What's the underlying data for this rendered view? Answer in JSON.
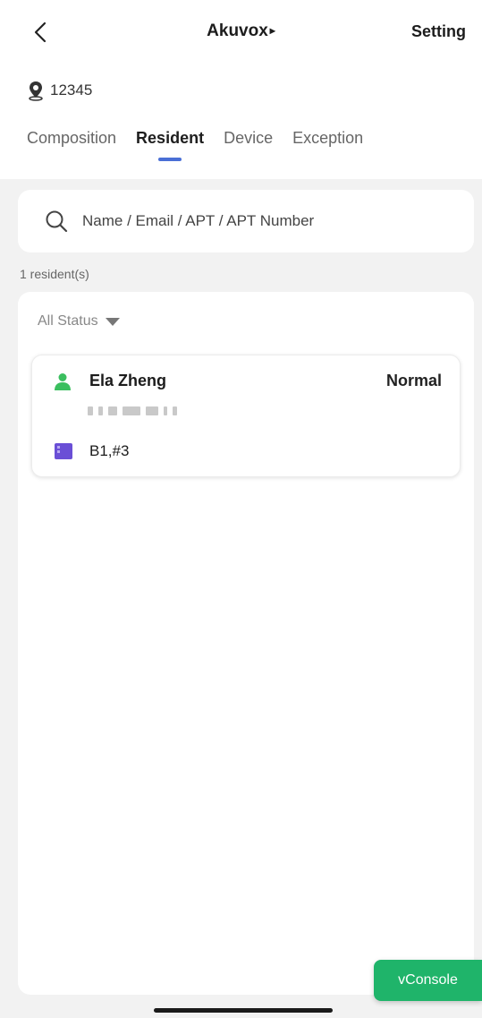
{
  "header": {
    "title": "Akuvox",
    "title_caret": "▸",
    "setting_label": "Setting"
  },
  "location": {
    "code": "12345"
  },
  "tabs": [
    {
      "label": "Composition",
      "active": false
    },
    {
      "label": "Resident",
      "active": true
    },
    {
      "label": "Device",
      "active": false
    },
    {
      "label": "Exception",
      "active": false
    }
  ],
  "search": {
    "placeholder": "Name / Email / APT / APT Number"
  },
  "summary": {
    "count_text": "1 resident(s)"
  },
  "filter": {
    "label": "All Status"
  },
  "residents": [
    {
      "name": "Ela Zheng",
      "status": "Normal",
      "apartment": "B1,#3"
    }
  ],
  "debug": {
    "vconsole_label": "vConsole"
  },
  "colors": {
    "accent": "#4a6fd6",
    "person_icon": "#3bbf5f",
    "apartment_icon": "#6a4fd6",
    "vconsole_bg": "#1fb46a"
  }
}
